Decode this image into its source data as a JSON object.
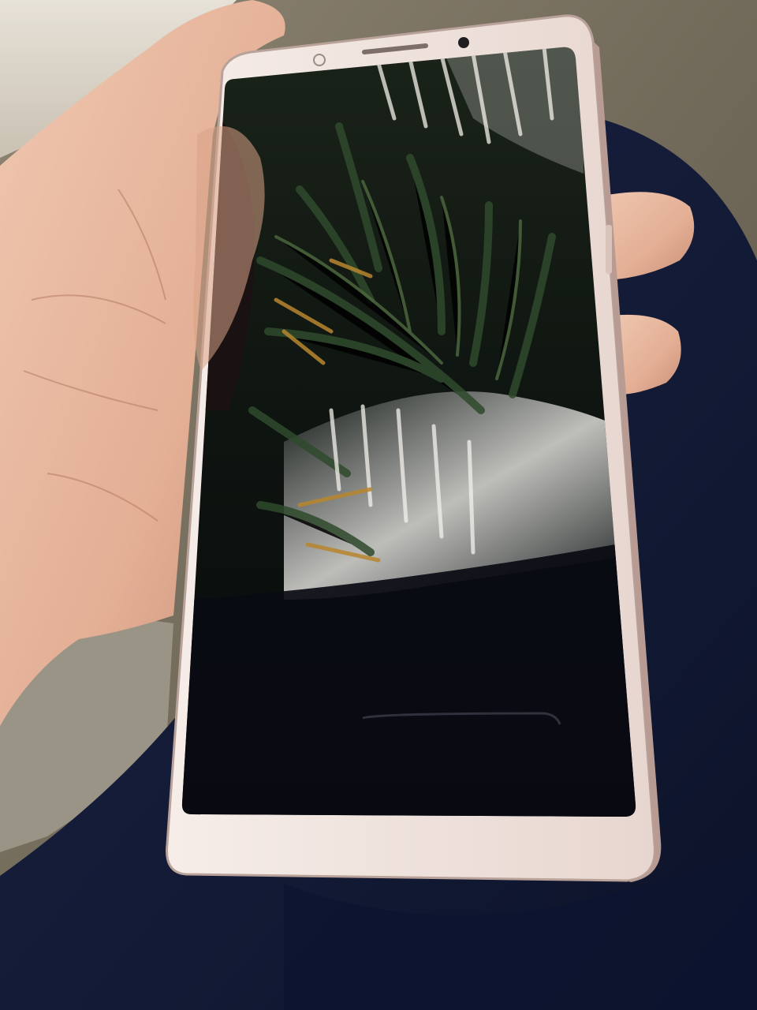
{
  "scene": {
    "subject": "smartphone-held-in-hand",
    "screen_state": "off",
    "phone_color": "#f1e4df",
    "screen_color": "#0b0d0f",
    "skin_color": "#e7b79e",
    "fabric_color": "#131a34",
    "ground_color": "#7b7261"
  }
}
